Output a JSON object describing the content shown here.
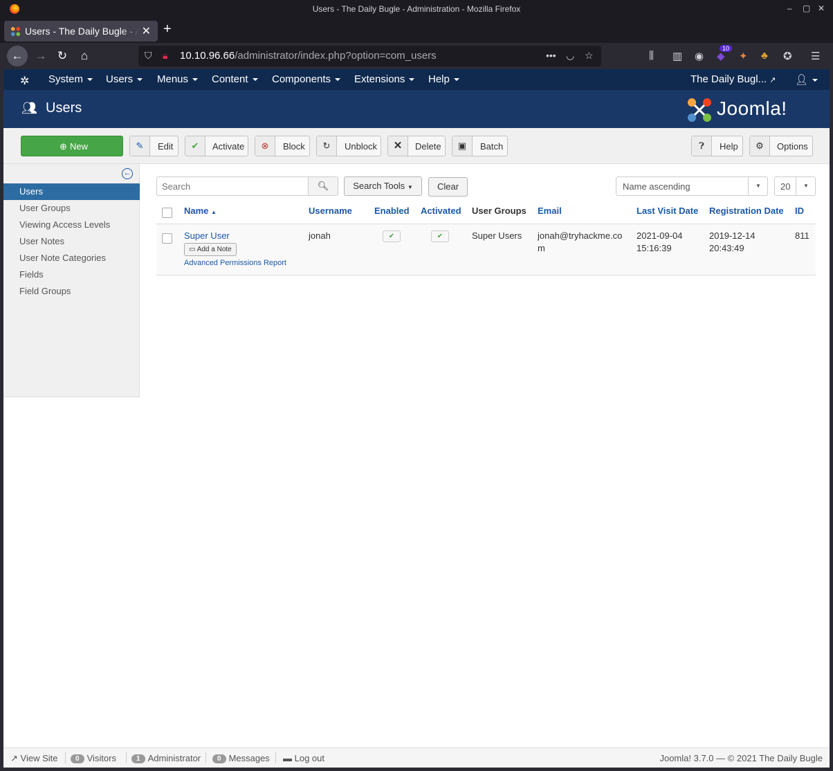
{
  "browser": {
    "window_title": "Users - The Daily Bugle - Administration - Mozilla Firefox",
    "tab_title": "Users - The Daily Bugle - Administration",
    "url_host": "10.10.96.66",
    "url_path": "/administrator/index.php?option=com_users",
    "extension_badge": "10"
  },
  "jnav": {
    "menus": [
      "System",
      "Users",
      "Menus",
      "Content",
      "Components",
      "Extensions",
      "Help"
    ],
    "site_link": "The Daily Bugl..."
  },
  "header": {
    "title": "Users",
    "brand": "Joomla!"
  },
  "toolbar": {
    "new": "New",
    "edit": "Edit",
    "activate": "Activate",
    "block": "Block",
    "unblock": "Unblock",
    "delete": "Delete",
    "batch": "Batch",
    "help": "Help",
    "options": "Options"
  },
  "sidebar": {
    "items": [
      "Users",
      "User Groups",
      "Viewing Access Levels",
      "User Notes",
      "User Note Categories",
      "Fields",
      "Field Groups"
    ]
  },
  "filters": {
    "search_placeholder": "Search",
    "search_tools": "Search Tools",
    "clear": "Clear",
    "ordering": "Name ascending",
    "limit": "20"
  },
  "table": {
    "headers": [
      "Name",
      "Username",
      "Enabled",
      "Activated",
      "User Groups",
      "Email",
      "Last Visit Date",
      "Registration Date",
      "ID"
    ],
    "row": {
      "name": "Super User",
      "add_note": "Add a Note",
      "permissions_link": "Advanced Permissions Report",
      "username": "jonah",
      "user_groups": "Super Users",
      "email_line1": "jonah@tryhackme.co",
      "email_line2": "m",
      "last_visit_date": "2021-09-04",
      "last_visit_time": "15:16:39",
      "reg_date": "2019-12-14",
      "reg_time": "20:43:49",
      "id": "811"
    }
  },
  "footer": {
    "view_site": "View Site",
    "visitors_count": "0",
    "visitors": "Visitors",
    "admin_count": "1",
    "admin": "Administrator",
    "messages_count": "0",
    "messages": "Messages",
    "logout": "Log out",
    "copyright": "Joomla! 3.7.0  —  © 2021 The Daily Bugle"
  }
}
